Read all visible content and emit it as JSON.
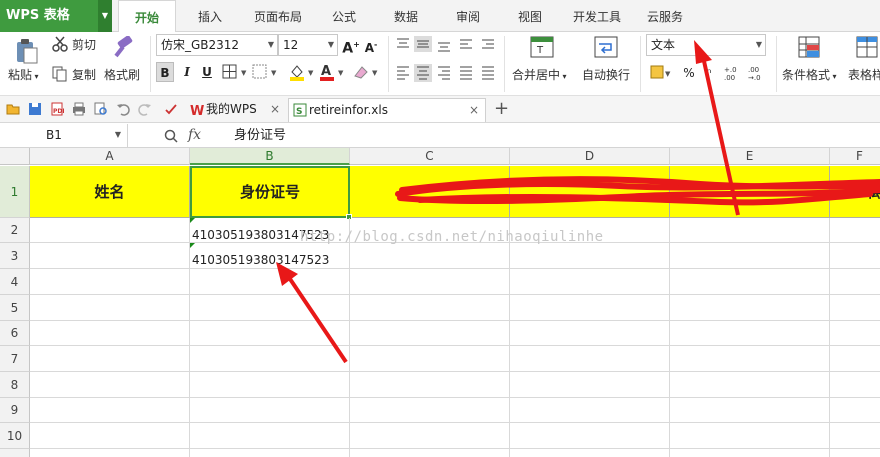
{
  "app": {
    "logo_letter": "S",
    "logo_text": "WPS 表格"
  },
  "menu": {
    "tabs": [
      "开始",
      "插入",
      "页面布局",
      "公式",
      "数据",
      "审阅",
      "视图",
      "开发工具",
      "云服务"
    ]
  },
  "ribbon": {
    "paste": "粘贴",
    "cut": "剪切",
    "copy": "复制",
    "format_painter": "格式刷",
    "font_name": "仿宋_GB2312",
    "font_size": "12",
    "merge_center": "合并居中",
    "wrap_text": "自动换行",
    "number_format": "文本",
    "percent": "%",
    "conditional_format": "条件格式",
    "table_style": "表格样"
  },
  "quick_access": {
    "doc_tab_1": "我的WPS",
    "doc_tab_2": "retireinfor.xls"
  },
  "formula_bar": {
    "name_box": "B1",
    "fx": "fx",
    "content": "身份证号"
  },
  "sheet": {
    "columns": [
      "A",
      "B",
      "C",
      "D",
      "E",
      "F"
    ],
    "rows": [
      "1",
      "2",
      "3",
      "4",
      "5",
      "6",
      "7",
      "8",
      "9",
      "10"
    ],
    "header_row": [
      "姓名",
      "身份证号",
      "",
      "",
      "",
      "离"
    ],
    "data": {
      "B2": "410305193803147523",
      "B3": "410305193803147523"
    },
    "selected_cell": "B1"
  },
  "watermark": "http://blog.csdn.net/nihaoqiulinhe",
  "colors": {
    "brand_green": "#3f9b3f",
    "header_fill": "#ffff00",
    "annotation_red": "#e81818"
  }
}
